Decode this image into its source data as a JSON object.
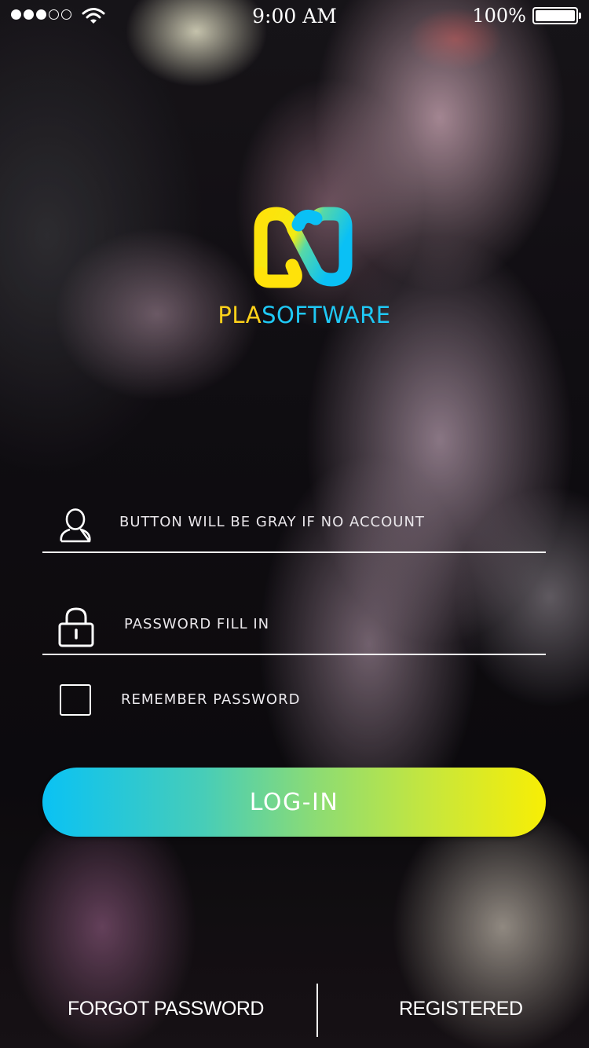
{
  "status_bar": {
    "time": "9:00 AM",
    "battery_percent": "100%",
    "signal_bars_filled": 3,
    "signal_bars_total": 5,
    "battery_level": 1.0
  },
  "brand": {
    "part1": "PLA",
    "part2": "SOFTWARE",
    "colors": {
      "yellow": "#ffd21a",
      "cyan": "#1fc8f5"
    }
  },
  "form": {
    "account_placeholder": "BUTTON WILL BE GRAY IF NO ACCOUNT",
    "password_placeholder": "PASSWORD FILL IN",
    "remember_label": "REMEMBER PASSWORD",
    "remember_checked": false,
    "login_label": "LOG-IN",
    "login_gradient": [
      "#0ac2f4",
      "#f8ee04"
    ]
  },
  "footer": {
    "forgot_label": "FORGOT PASSWORD",
    "register_label": "REGISTERED"
  },
  "icons": [
    "signal-icon",
    "wifi-icon",
    "battery-icon",
    "logo-icon",
    "user-icon",
    "lock-icon",
    "checkbox-icon"
  ]
}
